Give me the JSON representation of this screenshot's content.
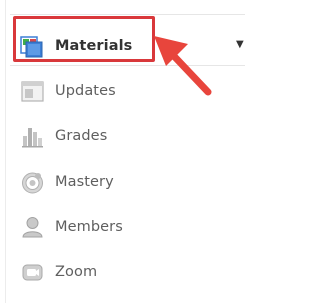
{
  "nav": {
    "items": [
      {
        "label": "Materials",
        "icon": "materials-icon",
        "active": true
      },
      {
        "label": "Updates",
        "icon": "updates-icon"
      },
      {
        "label": "Grades",
        "icon": "grades-icon"
      },
      {
        "label": "Mastery",
        "icon": "mastery-icon"
      },
      {
        "label": "Members",
        "icon": "members-icon"
      },
      {
        "label": "Zoom",
        "icon": "zoom-icon"
      }
    ]
  },
  "colors": {
    "highlight": "#d9383b",
    "arrow": "#e8453c",
    "active_text": "#333333",
    "inactive_text": "#5f5f5f",
    "icon_gray": "#bdbdbd",
    "materials_blue": "#3d7fd6",
    "materials_green": "#3fae49",
    "materials_red": "#d94949"
  }
}
